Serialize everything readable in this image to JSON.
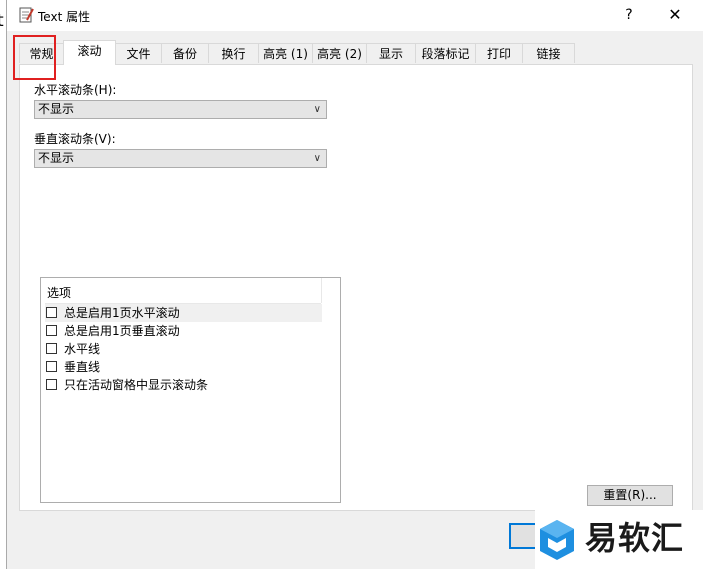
{
  "window": {
    "title": "Text 属性",
    "help_symbol": "?",
    "close_symbol": "✕",
    "left_stub_glyph": "t"
  },
  "tabs": [
    {
      "label": "常规"
    },
    {
      "label": "滚动",
      "active": true
    },
    {
      "label": "文件"
    },
    {
      "label": "备份"
    },
    {
      "label": "换行"
    },
    {
      "label": "高亮 (1)"
    },
    {
      "label": "高亮 (2)"
    },
    {
      "label": "显示"
    },
    {
      "label": "段落标记"
    },
    {
      "label": "打印"
    },
    {
      "label": "链接"
    }
  ],
  "scroll": {
    "horizontal_label": "水平滚动条(H):",
    "horizontal_value": "不显示",
    "vertical_label": "垂直滚动条(V):",
    "vertical_value": "不显示"
  },
  "options": {
    "header": "选项",
    "items": [
      {
        "label": "总是启用1页水平滚动",
        "checked": false
      },
      {
        "label": "总是启用1页垂直滚动",
        "checked": false
      },
      {
        "label": "水平线",
        "checked": false
      },
      {
        "label": "垂直线",
        "checked": false
      },
      {
        "label": "只在活动窗格中显示滚动条",
        "checked": false
      }
    ]
  },
  "buttons": {
    "reset_label": "重置(R)..."
  },
  "watermark": {
    "text": "易软汇"
  },
  "colors": {
    "accent": "#0078d7",
    "highlight_frame": "#e02020",
    "logo_blue": "#1e8fe0"
  }
}
